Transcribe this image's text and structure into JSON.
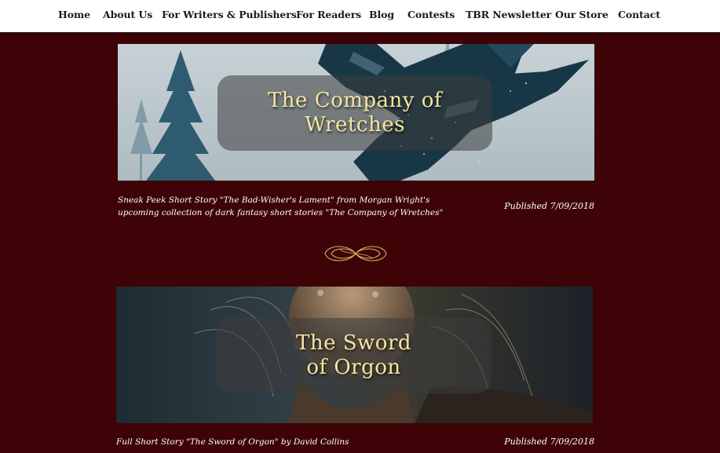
{
  "nav": {
    "items": [
      {
        "label": "Home"
      },
      {
        "label": "About Us"
      },
      {
        "label": "For Writers & Publishers"
      },
      {
        "label": "For Readers"
      },
      {
        "label": "Blog"
      },
      {
        "label": "Contests"
      },
      {
        "label": "TBR Newsletter"
      },
      {
        "label": "Our Store"
      },
      {
        "label": "Contact"
      }
    ]
  },
  "posts": [
    {
      "title": "The Company of\nWretches",
      "caption": "Sneak Peek Short Story \"The Bad-Wisher's Lament\" from Morgan Wright's upcoming collection of dark fantasy short stories \"The Company of Wretches\"",
      "published": "Published 7/09/2018"
    },
    {
      "title": "The Sword\nof Orgon",
      "caption": "Full Short Story \"The Sword of Orgon\" by David Collins",
      "published": "Published 7/09/2018"
    }
  ],
  "colors": {
    "page_background": "#3e0306",
    "nav_background": "#ffffff",
    "title_text": "#f3e6a0",
    "divider_gold": "#d4b46a"
  }
}
